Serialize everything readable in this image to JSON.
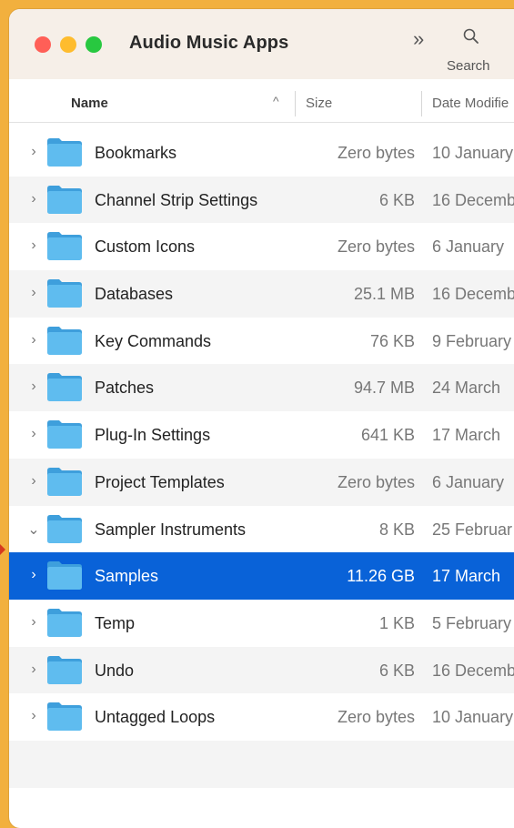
{
  "window": {
    "title": "Audio Music Apps"
  },
  "toolbar": {
    "more_icon": "chevron-double-right-icon",
    "search_label": "Search"
  },
  "columns": {
    "name": "Name",
    "size": "Size",
    "date": "Date Modifie"
  },
  "rows": [
    {
      "name": "Bookmarks",
      "size": "Zero bytes",
      "date": "10 January",
      "expanded": false
    },
    {
      "name": "Channel Strip Settings",
      "size": "6 KB",
      "date": "16 Decemb",
      "expanded": false
    },
    {
      "name": "Custom Icons",
      "size": "Zero bytes",
      "date": "6 January",
      "expanded": false
    },
    {
      "name": "Databases",
      "size": "25.1 MB",
      "date": "16 Decemb",
      "expanded": false
    },
    {
      "name": "Key Commands",
      "size": "76 KB",
      "date": "9 February",
      "expanded": false
    },
    {
      "name": "Patches",
      "size": "94.7 MB",
      "date": "24 March",
      "expanded": false
    },
    {
      "name": "Plug-In Settings",
      "size": "641 KB",
      "date": "17 March",
      "expanded": false
    },
    {
      "name": "Project Templates",
      "size": "Zero bytes",
      "date": "6 January",
      "expanded": false
    },
    {
      "name": "Sampler Instruments",
      "size": "8 KB",
      "date": "25 Februar",
      "expanded": true
    },
    {
      "name": "Samples",
      "size": "11.26 GB",
      "date": "17 March",
      "expanded": false,
      "selected": true
    },
    {
      "name": "Temp",
      "size": "1 KB",
      "date": "5 February",
      "expanded": false
    },
    {
      "name": "Undo",
      "size": "6 KB",
      "date": "16 Decemb",
      "expanded": false
    },
    {
      "name": "Untagged Loops",
      "size": "Zero bytes",
      "date": "10 January",
      "expanded": false
    }
  ],
  "colors": {
    "selection": "#0962d8",
    "folder": "#5fbcef",
    "desktop": "#f2b03e"
  }
}
